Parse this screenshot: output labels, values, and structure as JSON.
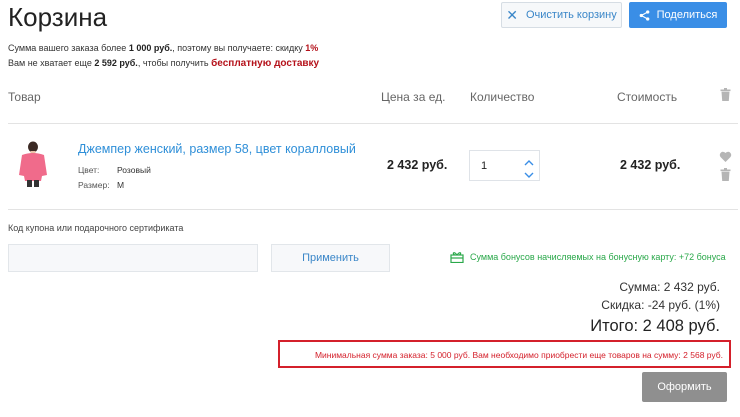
{
  "page": {
    "title": "Корзина"
  },
  "toolbar": {
    "clear_label": "Очистить корзину",
    "share_label": "Поделиться"
  },
  "notice": {
    "line1_prefix": "Сумма вашего заказа более ",
    "line1_amount": "1 000 руб.",
    "line1_middle": ", поэтому вы получаете: скидку ",
    "line1_discount": "1%",
    "line2_prefix": "Вам не хватает еще ",
    "line2_amount": "2 592 руб.",
    "line2_middle": ", чтобы получить ",
    "line2_goal": "бесплатную доставку"
  },
  "table": {
    "headers": {
      "product": "Товар",
      "price": "Цена за ед.",
      "quantity": "Количество",
      "cost": "Стоимость"
    }
  },
  "items": [
    {
      "name": "Джемпер женский, размер 58, цвет коралловый",
      "props": [
        {
          "label": "Цвет:",
          "value": "Розовый"
        },
        {
          "label": "Размер:",
          "value": "M"
        }
      ],
      "price": "2 432 руб.",
      "quantity": "1",
      "total": "2 432 руб."
    }
  ],
  "coupon": {
    "label": "Код купона или подарочного сертификата",
    "value": "",
    "apply_label": "Применить"
  },
  "bonus": {
    "text": "Сумма бонусов начисляемых на бонусную карту: +72 бонуса"
  },
  "summary": {
    "sum": "Сумма: 2 432 руб.",
    "discount": "Скидка: -24 руб. (1%)",
    "total": "Итого: 2 408 руб."
  },
  "min_order": {
    "text": "Минимальная сумма заказа: 5 000 руб. Вам необходимо приобрести еще товаров на сумму: 2 568 руб."
  },
  "order": {
    "label": "Оформить"
  },
  "colors": {
    "accent": "#3a8ee6",
    "link": "#2f8fd8",
    "alert": "#d4202b",
    "bonus": "#2aa84a",
    "discount": "#b5121b"
  }
}
